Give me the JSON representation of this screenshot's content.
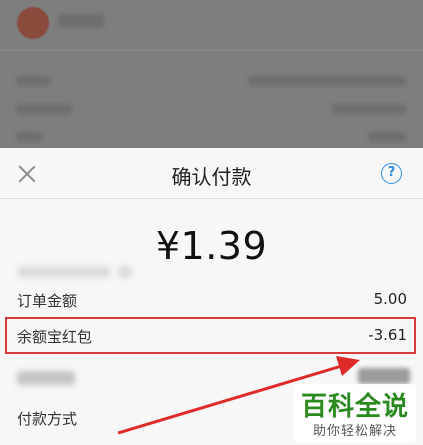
{
  "sheet": {
    "title": "确认付款",
    "amount": "¥1.39",
    "help_glyph": "?",
    "rows": [
      {
        "label": "订单金额",
        "value": "5.00"
      },
      {
        "label": "余额宝红包",
        "value": "-3.61"
      },
      {
        "label": "付款方式",
        "value": ""
      }
    ]
  },
  "watermark": {
    "title": "百科全说",
    "subtitle": "助你轻松解决"
  },
  "colors": {
    "accent_blue": "#2f8fe0",
    "highlight_red": "#d93b3b",
    "watermark_green": "#2b8a1f"
  },
  "icons": [
    "close-icon",
    "help-icon",
    "avatar-icon"
  ]
}
